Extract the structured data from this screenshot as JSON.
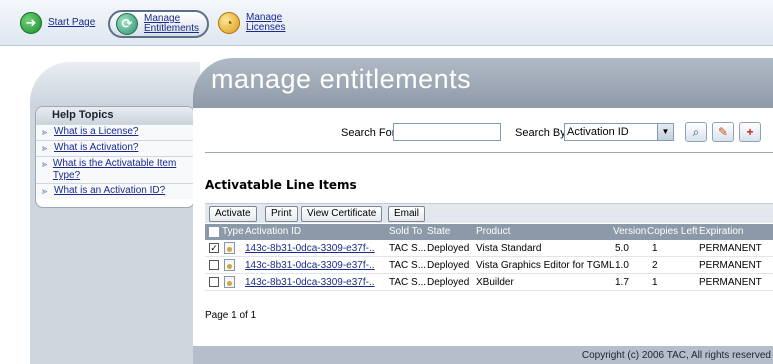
{
  "nav": {
    "start_label": "Start Page",
    "entitlements_line1": "Manage",
    "entitlements_line2": "Entitlements",
    "licenses_line1": "Manage",
    "licenses_line2": "Licenses"
  },
  "header": {
    "title": "manage entitlements"
  },
  "help": {
    "title": "Help Topics",
    "items": [
      {
        "label": "What is a License?"
      },
      {
        "label": "What is Activation?"
      },
      {
        "label": "What is the Activatable Item Type?"
      },
      {
        "label": "What is an Activation ID?"
      }
    ]
  },
  "search": {
    "for_label": "Search For",
    "for_value": "",
    "by_label": "Search By",
    "by_value": "Activation ID"
  },
  "section": {
    "title": "Activatable Line Items"
  },
  "toolbar": {
    "activate": "Activate",
    "print": "Print",
    "view_certificate": "View Certificate",
    "email": "Email"
  },
  "table": {
    "headers": {
      "type": "Type",
      "activation_id": "Activation ID",
      "sold_to": "Sold To",
      "state": "State",
      "product": "Product",
      "version": "Version",
      "copies_left": "Copies Left",
      "expiration": "Expiration"
    },
    "rows": [
      {
        "checked": true,
        "activation_id": "143c-8b31-0dca-3309-e37f-..",
        "sold_to": "TAC S...",
        "state": "Deployed",
        "product": "Vista Standard",
        "version": "5.0",
        "copies_left": "1",
        "expiration": "PERMANENT"
      },
      {
        "checked": false,
        "activation_id": "143c-8b31-0dca-3309-e37f-..",
        "sold_to": "TAC S...",
        "state": "Deployed",
        "product": "Vista Graphics Editor for TGML",
        "version": "1.0",
        "copies_left": "2",
        "expiration": "PERMANENT"
      },
      {
        "checked": false,
        "activation_id": "143c-8b31-0dca-3309-e37f-..",
        "sold_to": "TAC S...",
        "state": "Deployed",
        "product": "XBuilder",
        "version": "1.7",
        "copies_left": "1",
        "expiration": "PERMANENT"
      }
    ]
  },
  "pager": {
    "text": "Page 1 of 1"
  },
  "footer": {
    "copyright": "Copyright (c) 2006 TAC, All rights reserved"
  }
}
